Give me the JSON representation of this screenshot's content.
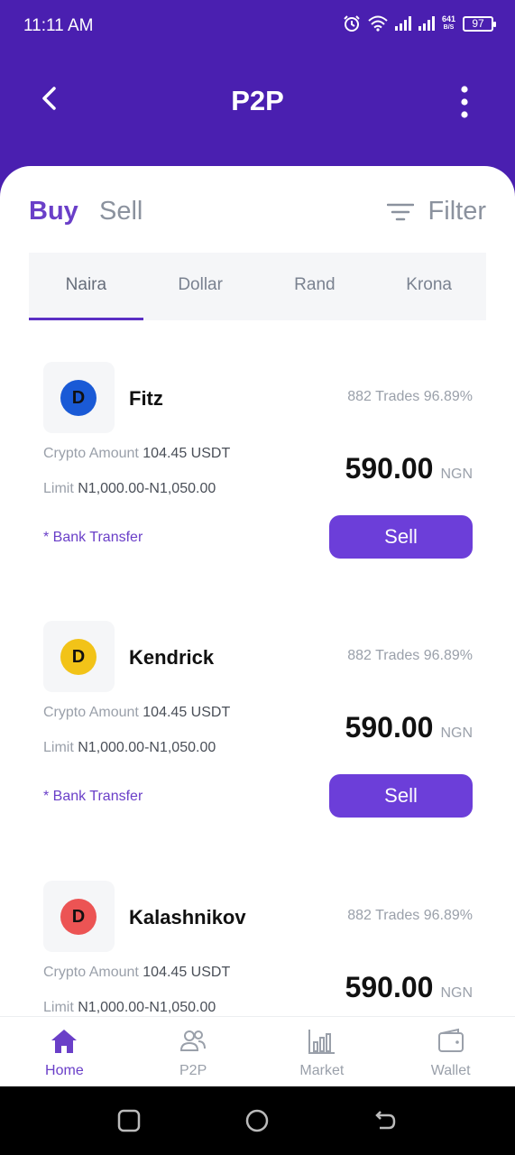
{
  "status_bar": {
    "time": "11:11 AM",
    "speed_value": "641",
    "speed_unit": "B/S",
    "battery": "97",
    "icons": [
      "alarm-icon",
      "wifi-icon",
      "signal-icon",
      "signal-icon"
    ]
  },
  "app_bar": {
    "title": "P2P",
    "back_icon": "chevron-left-icon",
    "more_icon": "more-vertical-icon"
  },
  "mode_tabs": [
    {
      "label": "Buy",
      "active": true
    },
    {
      "label": "Sell",
      "active": false
    }
  ],
  "filter": {
    "label": "Filter",
    "icon": "filter-icon"
  },
  "currency_tabs": [
    {
      "label": "Naira",
      "active": true
    },
    {
      "label": "Dollar",
      "active": false
    },
    {
      "label": "Rand",
      "active": false
    },
    {
      "label": "Krona",
      "active": false
    }
  ],
  "offers": [
    {
      "initial": "D",
      "avatar_color": "#1a5ad6",
      "name": "Fitz",
      "trades": "882 Trades 96.89%",
      "crypto_label": "Crypto Amount",
      "crypto_value": "104.45 USDT",
      "limit_label": "Limit",
      "limit_value": "N1,000.00-N1,050.00",
      "price": "590.00",
      "currency": "NGN",
      "method": "* Bank Transfer",
      "button": "Sell"
    },
    {
      "initial": "D",
      "avatar_color": "#f2c318",
      "name": "Kendrick",
      "trades": "882 Trades 96.89%",
      "crypto_label": "Crypto Amount",
      "crypto_value": "104.45 USDT",
      "limit_label": "Limit",
      "limit_value": "N1,000.00-N1,050.00",
      "price": "590.00",
      "currency": "NGN",
      "method": "* Bank Transfer",
      "button": "Sell"
    },
    {
      "initial": "D",
      "avatar_color": "#ec5454",
      "name": "Kalashnikov",
      "trades": "882 Trades 96.89%",
      "crypto_label": "Crypto Amount",
      "crypto_value": "104.45 USDT",
      "limit_label": "Limit",
      "limit_value": "N1,000.00-N1,050.00",
      "price": "590.00",
      "currency": "NGN"
    }
  ],
  "bottom_nav": [
    {
      "label": "Home",
      "icon": "home-icon",
      "active": true
    },
    {
      "label": "P2P",
      "icon": "users-icon",
      "active": false
    },
    {
      "label": "Market",
      "icon": "bar-chart-icon",
      "active": false
    },
    {
      "label": "Wallet",
      "icon": "wallet-icon",
      "active": false
    }
  ],
  "colors": {
    "header": "#4a1fb0",
    "accent": "#6c3ed9",
    "muted": "#9aa0aa"
  }
}
